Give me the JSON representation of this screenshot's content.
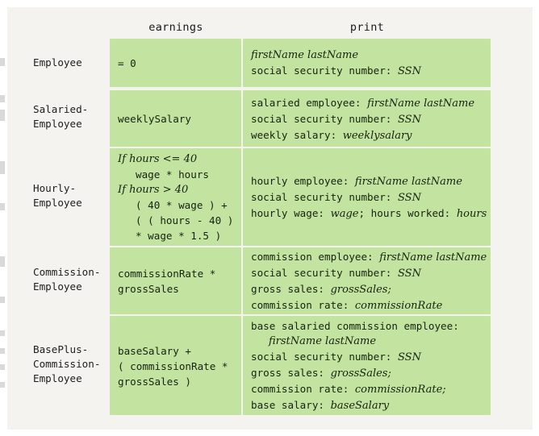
{
  "figure": {
    "headers": {
      "earnings": "earnings",
      "print": "print"
    },
    "colors": {
      "cell_green": "#c3e3a1",
      "page_background": "#f4f3f0",
      "text": "#16240c"
    },
    "rows": [
      {
        "label": "Employee",
        "earnings": [
          {
            "text": "= 0",
            "style": "mono",
            "indent": false
          }
        ],
        "print": [
          {
            "text": "firstName lastName",
            "style": "italic",
            "indent": false
          },
          {
            "text": "social security number: ",
            "style": "mono",
            "italic_tail": "SSN",
            "indent": false
          }
        ]
      },
      {
        "label": "Salaried-\nEmployee",
        "earnings": [
          {
            "text": "weeklySalary",
            "style": "mono",
            "indent": false
          }
        ],
        "print": [
          {
            "text": "salaried employee: ",
            "style": "mono",
            "italic_tail": "firstName lastName",
            "indent": false
          },
          {
            "text": "social security number: ",
            "style": "mono",
            "italic_tail": "SSN",
            "indent": false
          },
          {
            "text": "weekly salary: ",
            "style": "mono",
            "italic_tail": "weeklysalary",
            "indent": false
          }
        ]
      },
      {
        "label": "Hourly-\nEmployee",
        "earnings": [
          {
            "text": "If hours <= 40",
            "style": "italic",
            "indent": false
          },
          {
            "text": "wage * hours",
            "style": "mono",
            "indent": true
          },
          {
            "text": "If hours > 40",
            "style": "italic",
            "indent": false
          },
          {
            "text": "( 40 * wage ) +",
            "style": "mono",
            "indent": true
          },
          {
            "text": "( ( hours - 40 )",
            "style": "mono",
            "indent": true
          },
          {
            "text": "* wage * 1.5 )",
            "style": "mono",
            "indent": true
          }
        ],
        "print": [
          {
            "text": "hourly employee: ",
            "style": "mono",
            "italic_tail": "firstName lastName",
            "indent": false
          },
          {
            "text": "social security number: ",
            "style": "mono",
            "italic_tail": "SSN",
            "indent": false
          },
          {
            "text": "hourly wage: ",
            "style": "mono",
            "italic_mid": "wage",
            "mid_tail": "; hours worked: ",
            "italic_tail": "hours",
            "indent": false
          }
        ]
      },
      {
        "label": "Commission-\nEmployee",
        "earnings": [
          {
            "text": "commissionRate *",
            "style": "mono",
            "indent": false
          },
          {
            "text": "grossSales",
            "style": "mono",
            "indent": false
          }
        ],
        "print": [
          {
            "text": "commission employee: ",
            "style": "mono",
            "italic_tail": "firstName lastName",
            "indent": false
          },
          {
            "text": "social security number: ",
            "style": "mono",
            "italic_tail": "SSN",
            "indent": false
          },
          {
            "text": "gross sales: ",
            "style": "mono",
            "italic_tail": "grossSales;",
            "indent": false
          },
          {
            "text": "commission rate: ",
            "style": "mono",
            "italic_tail": "commissionRate",
            "indent": false
          }
        ]
      },
      {
        "label": "BasePlus-\nCommission-\nEmployee",
        "earnings": [
          {
            "text": "baseSalary +",
            "style": "mono",
            "indent": false
          },
          {
            "text": "( commissionRate *",
            "style": "mono",
            "indent": false
          },
          {
            "text": "grossSales )",
            "style": "mono",
            "indent": false
          }
        ],
        "print": [
          {
            "text": "base salaried commission employee:",
            "style": "mono",
            "indent": false
          },
          {
            "text": "firstName lastName",
            "style": "italic",
            "indent": true
          },
          {
            "text": "social security number: ",
            "style": "mono",
            "italic_tail": "SSN",
            "indent": false
          },
          {
            "text": "gross sales: ",
            "style": "mono",
            "italic_tail": "grossSales;",
            "indent": false
          },
          {
            "text": "commission rate: ",
            "style": "mono",
            "italic_tail": "commissionRate;",
            "indent": false
          },
          {
            "text": "base salary: ",
            "style": "mono",
            "italic_tail": "baseSalary",
            "indent": false
          }
        ]
      }
    ]
  }
}
